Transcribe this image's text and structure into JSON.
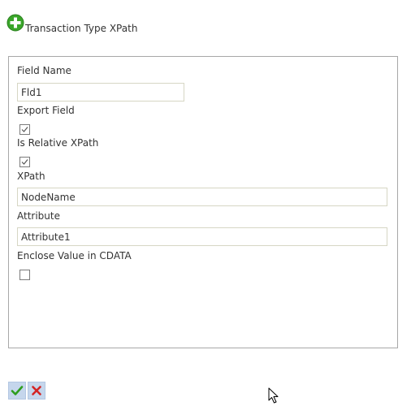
{
  "header": {
    "title": "Transaction Type XPath",
    "icon": "add-circle-icon"
  },
  "form": {
    "field_name": {
      "label": "Field Name",
      "value": "Fld1"
    },
    "export_field": {
      "label": "Export Field",
      "checked": true
    },
    "is_relative_xpath": {
      "label": "Is Relative XPath",
      "checked": true
    },
    "xpath": {
      "label": "XPath",
      "value": "NodeName"
    },
    "attribute": {
      "label": "Attribute",
      "value": "Attribute1"
    },
    "enclose_cdata": {
      "label": "Enclose Value in CDATA",
      "checked": false
    }
  },
  "toolbar": {
    "save_icon": "checkmark-icon",
    "cancel_icon": "x-icon"
  },
  "colors": {
    "add_icon_green": "#3aa62a",
    "check_green": "#2e9e1f",
    "cancel_red": "#d42424",
    "button_bg": "#c5d6ec",
    "panel_border": "#a8a8a8",
    "input_border": "#d6d6c4"
  }
}
